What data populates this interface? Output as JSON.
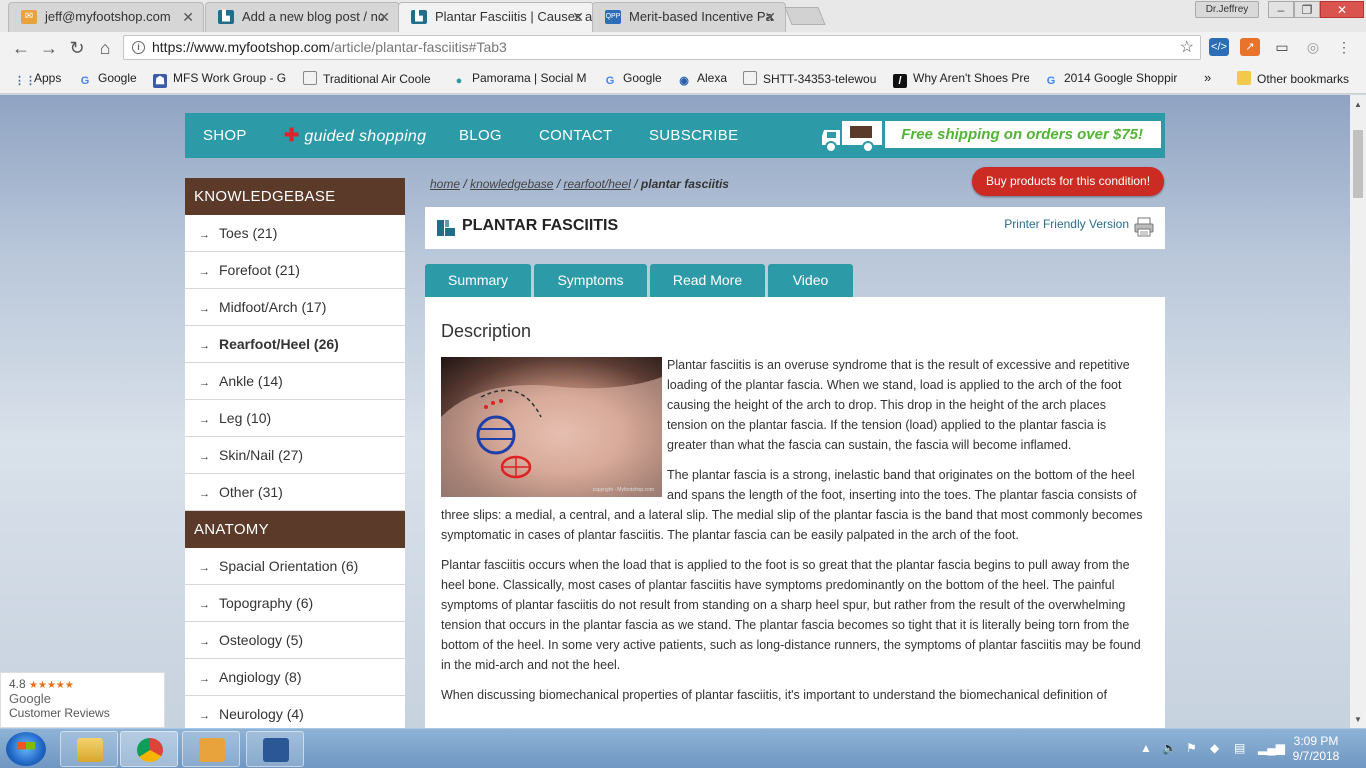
{
  "browser": {
    "tabs": [
      {
        "title": "jeff@myfootshop.com",
        "icon": "mail-icon",
        "color": "#e8a33d"
      },
      {
        "title": "Add a new blog post / nc",
        "icon": "mfs-icon",
        "color": "#1f6f8b"
      },
      {
        "title": "Plantar Fasciitis | Causes a",
        "icon": "mfs-icon",
        "color": "#1f6f8b"
      },
      {
        "title": "Merit-based Incentive Pa",
        "icon": "qpp-icon",
        "color": "#2d6db5"
      }
    ],
    "profile": "Dr.Jeffrey",
    "url_host": "https://www.myfootshop.com",
    "url_path": "/article/plantar-fasciitis#Tab3",
    "bookmarks": [
      {
        "label": "Apps",
        "icon": "apps-grid-icon"
      },
      {
        "label": "Google",
        "icon": "google-icon"
      },
      {
        "label": "MFS Work Group - G",
        "icon": "group-icon"
      },
      {
        "label": "Traditional Air Coole",
        "icon": "page-icon"
      },
      {
        "label": "Pamorama | Social M",
        "icon": "chat-bubble-icon"
      },
      {
        "label": "Google",
        "icon": "google-icon"
      },
      {
        "label": "Alexa",
        "icon": "alexa-icon"
      },
      {
        "label": "SHTT-34353-telewou",
        "icon": "page-icon"
      },
      {
        "label": "Why Aren't Shoes Pre",
        "icon": "site-icon"
      },
      {
        "label": "2014 Google Shoppir",
        "icon": "google-icon"
      }
    ],
    "more_bookmarks": "»",
    "other_bookmarks": "Other bookmarks"
  },
  "site_nav": {
    "items": [
      "SHOP",
      "guided shopping",
      "BLOG",
      "CONTACT",
      "SUBSCRIBE"
    ],
    "shipping": "Free shipping on orders over $75!"
  },
  "sidebar": {
    "knowledgebase_title": "KNOWLEDGEBASE",
    "knowledgebase": [
      {
        "label": "Toes (21)"
      },
      {
        "label": "Forefoot (21)"
      },
      {
        "label": "Midfoot/Arch (17)"
      },
      {
        "label": "Rearfoot/Heel (26)"
      },
      {
        "label": "Ankle (14)"
      },
      {
        "label": "Leg (10)"
      },
      {
        "label": "Skin/Nail (27)"
      },
      {
        "label": "Other (31)"
      }
    ],
    "anatomy_title": "ANATOMY",
    "anatomy": [
      {
        "label": "Spacial Orientation (6)"
      },
      {
        "label": "Topography (6)"
      },
      {
        "label": "Osteology (5)"
      },
      {
        "label": "Angiology (8)"
      },
      {
        "label": "Neurology (4)"
      }
    ]
  },
  "breadcrumb": {
    "home": "home",
    "kb": "knowledgebase",
    "section": "rearfoot/heel",
    "current": "plantar fasciitis",
    "sep": "/"
  },
  "buy_button": "Buy products for this condition!",
  "article": {
    "title": "PLANTAR FASCIITIS",
    "printer_friendly": "Printer Friendly Version",
    "tabs": [
      "Summary",
      "Symptoms",
      "Read More",
      "Video"
    ],
    "heading": "Description",
    "photo_credit": "copyright - Myfootshop.com",
    "paragraphs": [
      "Plantar fasciitis is an overuse syndrome that is the result of excessive and repetitive loading of the plantar fascia. When we stand, load is applied to the arch of the foot causing the height of the arch to drop. This drop in the height of the arch places tension on the plantar fascia. If the tension (load) applied to the plantar fascia is greater than what the fascia can sustain, the fascia will become inflamed.",
      "The plantar fascia is a strong, inelastic band that originates on the bottom of the heel and spans the length of the foot, inserting into the toes. The plantar fascia consists of three slips: a medial, a central, and a lateral slip. The medial slip of the plantar fascia is the band that most commonly becomes symptomatic in cases of plantar fasciitis. The plantar fascia can be easily palpated in the arch of the foot.",
      "Plantar fasciitis occurs when the load that is applied to the foot is so great that the plantar fascia begins to pull away from the heel bone. Classically, most cases of plantar fasciitis have symptoms predominantly on the bottom of the heel. The painful symptoms of plantar fasciitis do not result from standing on a sharp heel spur, but rather from the result of the overwhelming tension that occurs in the plantar fascia as we stand. The plantar fascia becomes so tight that it is literally being torn from the bottom of the heel. In some very active patients, such as long-distance runners, the symptoms of plantar fasciitis may be found in the mid-arch and not the heel.",
      "When discussing biomechanical properties of plantar fasciitis, it's important to understand the biomechanical definition of"
    ]
  },
  "google_badge": {
    "rating": "4.8",
    "stars": "★★★★★",
    "brand": "Google",
    "label": "Customer Reviews"
  },
  "taskbar": {
    "time": "3:09 PM",
    "date": "9/7/2018"
  },
  "colors": {
    "teal": "#2d9aa8",
    "brown": "#5b3a29",
    "red": "#cc2b23",
    "green": "#52b435"
  }
}
